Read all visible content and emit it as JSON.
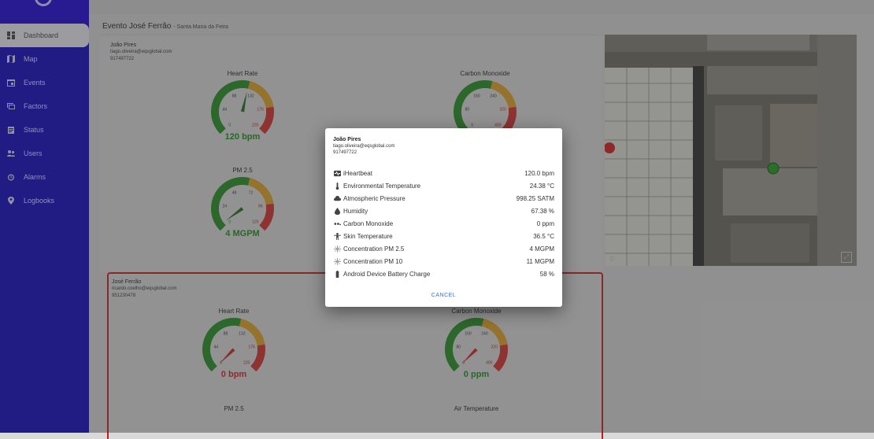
{
  "sidebar": {
    "items": [
      {
        "label": "Dashboard",
        "icon": "dashboard-icon",
        "active": true
      },
      {
        "label": "Map",
        "icon": "map-icon"
      },
      {
        "label": "Events",
        "icon": "calendar-icon"
      },
      {
        "label": "Factors",
        "icon": "devices-icon"
      },
      {
        "label": "Status",
        "icon": "clipboard-icon"
      },
      {
        "label": "Users",
        "icon": "users-icon"
      },
      {
        "label": "Alarms",
        "icon": "alarm-icon"
      },
      {
        "label": "Logbooks",
        "icon": "location-pin-icon"
      }
    ]
  },
  "event": {
    "title": "Evento José Ferrão",
    "place": "- Santa Maria da Feira"
  },
  "card1": {
    "name": "João Pires",
    "email": "tiago.oliveira@eqsglobal.com",
    "phone": "917497722",
    "gauges": {
      "heart_rate": {
        "title": "Heart Rate",
        "value": "120 bpm",
        "reading": 120,
        "max": 220,
        "ticks": [
          "0",
          "44",
          "88",
          "132",
          "176",
          "220"
        ]
      },
      "co": {
        "title": "Carbon Monoxide",
        "ticks": [
          "0",
          "80",
          "160",
          "240",
          "320",
          "400"
        ]
      },
      "pm25": {
        "title": "PM 2.5",
        "value": "4 MGPM",
        "reading": 4,
        "max": 120,
        "ticks": [
          "0",
          "24",
          "48",
          "72",
          "96",
          "120"
        ]
      }
    }
  },
  "card2": {
    "name": "José Ferrão",
    "email": "ricardo.coelho@eqsglobal.com",
    "phone": "951230478",
    "gauges": {
      "heart_rate": {
        "title": "Heart Rate",
        "value": "0 bpm",
        "reading": 0,
        "max": 220,
        "ticks": [
          "0",
          "44",
          "88",
          "132",
          "176",
          "220"
        ]
      },
      "co": {
        "title": "Carbon Monoxide",
        "value": "0 ppm",
        "reading": 0,
        "max": 400,
        "ticks": [
          "0",
          "80",
          "160",
          "240",
          "320",
          "400"
        ]
      },
      "pm25": {
        "title": "PM 2.5"
      },
      "air_temp": {
        "title": "Air Temperature"
      }
    }
  },
  "map": {
    "credit": "©"
  },
  "dialog": {
    "name": "João Pires",
    "email": "tiago.oliveira@eqsglobal.com",
    "phone": "917497722",
    "metrics": [
      {
        "icon": "heartbeat-icon",
        "label": "iHeartbeat",
        "value": "120.0 bpm"
      },
      {
        "icon": "thermometer-icon",
        "label": "Environmental Temperature",
        "value": "24.38 °C"
      },
      {
        "icon": "cloud-icon",
        "label": "Atmospheric Pressure",
        "value": "998.25 SATM"
      },
      {
        "icon": "humidity-icon",
        "label": "Humidity",
        "value": "67.38 %"
      },
      {
        "icon": "co-icon",
        "label": "Carbon Monoxide",
        "value": "0 ppm"
      },
      {
        "icon": "person-icon",
        "label": "Skin Temperature",
        "value": "36.5 °C"
      },
      {
        "icon": "particles-icon",
        "label": "Concentration PM 2.5",
        "value": "4 MGPM"
      },
      {
        "icon": "particles-icon",
        "label": "Concentration PM 10",
        "value": "11 MGPM"
      },
      {
        "icon": "battery-icon",
        "label": "Android Device Battery Charge",
        "value": "58 %"
      }
    ],
    "cancel_label": "CANCEL"
  },
  "colors": {
    "sidebar": "#0b00c0",
    "alert_border": "#c61a1a",
    "ok_text": "#1a8a1a",
    "bad_text": "#d02020",
    "link": "#3b6fd6"
  }
}
